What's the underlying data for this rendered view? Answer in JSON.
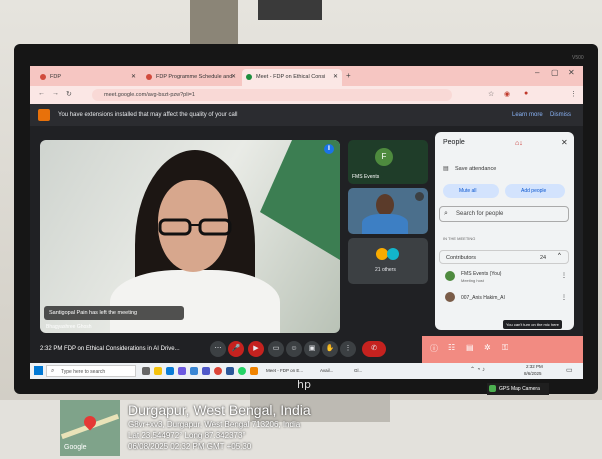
{
  "browser": {
    "tabs": [
      {
        "label": "FDP"
      },
      {
        "label": "FDP Programme Schedule and"
      },
      {
        "label": "Meet - FDP on Ethical Consi"
      }
    ],
    "new_tab": "+",
    "url": "meet.google.com/avg-bszt-pzw?pli=1",
    "ext_message": "You have extensions installed that may affect the quality of your call",
    "learn_more": "Learn more",
    "dismiss": "Dismiss",
    "screen_label": "V500"
  },
  "meet": {
    "toast": "Santigopal Pain has left the meeting",
    "speaker_name": "Bhagyashree Ghosh",
    "tile1_letter": "F",
    "tile1_name": "FMS Events",
    "others_label": "21 others",
    "time": "2:32 PM",
    "title": "FDP on Ethical Considerations in AI Drive..."
  },
  "people": {
    "title": "People",
    "save_attendance": "Save attendance",
    "mute_all": "Mute all",
    "add_people": "Add people",
    "search_placeholder": "Search for people",
    "in_meeting": "IN THE MEETING",
    "contributors": "Contributors",
    "contributor_count": "24",
    "p1_name": "FMS Events (You)",
    "p1_sub": "Meeting host",
    "p2_name": "007_Anis Hakim_AI",
    "tooltip": "You can't turn on the mic here"
  },
  "taskbar": {
    "search_placeholder": "Type here to search",
    "sys_time": "2:32 PM",
    "sys_date": "8/6/2025",
    "items": [
      "Meet - FDP on E...",
      "Avail...",
      "Gl..."
    ]
  },
  "geotag": {
    "city": "Durgapur, West Bengal, India",
    "address": "G8vr+xv3, Durgapur, West Bengal 713206, India",
    "coords": "Lat 23.544972° Long 87.342373°",
    "datetime": "06/08/2025 02:32 PM GMT +05:30",
    "map_brand": "Google",
    "app_badge": "GPS Map Camera"
  },
  "monitor": {
    "logo": "hp"
  }
}
